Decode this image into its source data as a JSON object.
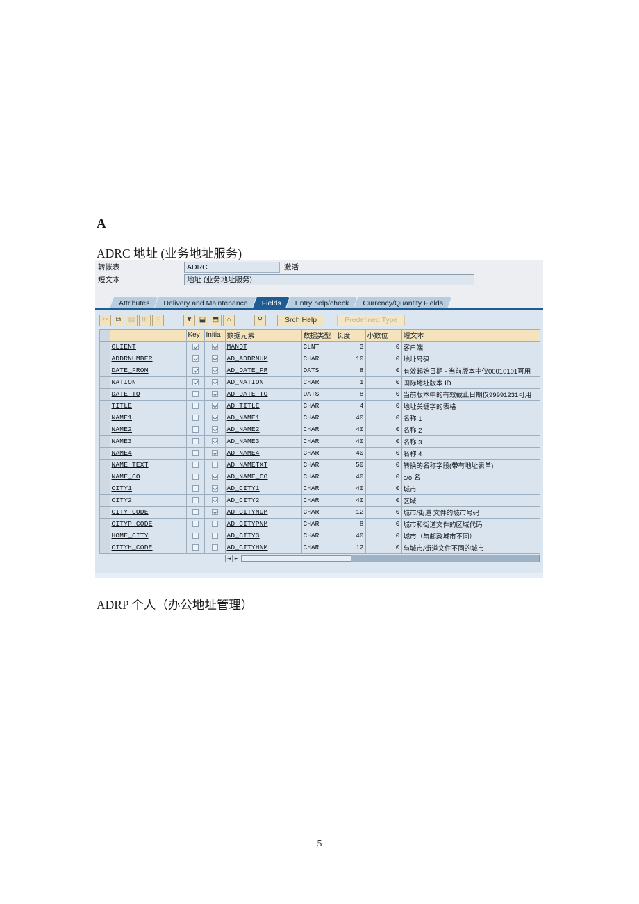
{
  "document": {
    "section_letter": "A",
    "adrc_caption": "ADRC 地址 (业务地址服务)",
    "adrp_caption": "ADRP 个人（办公地址管理）",
    "page_number": "5"
  },
  "sap": {
    "form": {
      "row1_label": "转帐表",
      "row1_value": "ADRC",
      "row1_status": "激活",
      "row2_label": "短文本",
      "row2_value": "地址 (业务地址服务)"
    },
    "tabs": [
      {
        "label": "Attributes",
        "active": false
      },
      {
        "label": "Delivery and Maintenance",
        "active": false
      },
      {
        "label": "Fields",
        "active": true
      },
      {
        "label": "Entry help/check",
        "active": false
      },
      {
        "label": "Currency/Quantity Fields",
        "active": false
      }
    ],
    "toolbar": {
      "icons": [
        {
          "name": "cut-icon",
          "glyph": "✂",
          "disabled": true
        },
        {
          "name": "copy-icon",
          "glyph": "⧉",
          "disabled": false
        },
        {
          "name": "paste-icon",
          "glyph": "▤",
          "disabled": true
        },
        {
          "name": "insert-row-icon",
          "glyph": "⊞",
          "disabled": true
        },
        {
          "name": "delete-row-icon",
          "glyph": "⊟",
          "disabled": true
        },
        {
          "name": "filter-icon",
          "glyph": "▼",
          "disabled": false
        },
        {
          "name": "append-row-icon",
          "glyph": "⬓",
          "disabled": false
        },
        {
          "name": "insert-line-icon",
          "glyph": "⬒",
          "disabled": false
        },
        {
          "name": "sort-icon",
          "glyph": "⌂",
          "disabled": false
        },
        {
          "name": "data-element-icon",
          "glyph": "⚲",
          "disabled": false
        }
      ],
      "srch_help_label": "Srch Help",
      "predefined_type_label": "Predefined Type"
    },
    "grid": {
      "columns": [
        {
          "key": "field",
          "label": ""
        },
        {
          "key": "key",
          "label": "Key"
        },
        {
          "key": "initial",
          "label": "Initia"
        },
        {
          "key": "data_element",
          "label": "数据元素"
        },
        {
          "key": "data_type",
          "label": "数据类型"
        },
        {
          "key": "length",
          "label": "长度"
        },
        {
          "key": "decimals",
          "label": "小数位"
        },
        {
          "key": "short_text",
          "label": "短文本"
        }
      ],
      "rows": [
        {
          "field": "CLIENT",
          "key": true,
          "initial": true,
          "data_element": "MANDT",
          "data_type": "CLNT",
          "length": "3",
          "decimals": "0",
          "short_text": "客户端"
        },
        {
          "field": "ADDRNUMBER",
          "key": true,
          "initial": true,
          "data_element": "AD_ADDRNUM",
          "data_type": "CHAR",
          "length": "10",
          "decimals": "0",
          "short_text": "地址号码"
        },
        {
          "field": "DATE_FROM",
          "key": true,
          "initial": true,
          "data_element": "AD_DATE_FR",
          "data_type": "DATS",
          "length": "8",
          "decimals": "0",
          "short_text": "有效起始日期 - 当前版本中仅00010101可用"
        },
        {
          "field": "NATION",
          "key": true,
          "initial": true,
          "data_element": "AD_NATION",
          "data_type": "CHAR",
          "length": "1",
          "decimals": "0",
          "short_text": "国际地址版本 ID"
        },
        {
          "field": "DATE_TO",
          "key": false,
          "initial": true,
          "data_element": "AD_DATE_TO",
          "data_type": "DATS",
          "length": "8",
          "decimals": "0",
          "short_text": "当前版本中的有效截止日期仅99991231可用"
        },
        {
          "field": "TITLE",
          "key": false,
          "initial": true,
          "data_element": "AD_TITLE",
          "data_type": "CHAR",
          "length": "4",
          "decimals": "0",
          "short_text": "地址关键字的表格"
        },
        {
          "field": "NAME1",
          "key": false,
          "initial": true,
          "data_element": "AD_NAME1",
          "data_type": "CHAR",
          "length": "40",
          "decimals": "0",
          "short_text": "名称 1"
        },
        {
          "field": "NAME2",
          "key": false,
          "initial": true,
          "data_element": "AD_NAME2",
          "data_type": "CHAR",
          "length": "40",
          "decimals": "0",
          "short_text": "名称 2"
        },
        {
          "field": "NAME3",
          "key": false,
          "initial": true,
          "data_element": "AD_NAME3",
          "data_type": "CHAR",
          "length": "40",
          "decimals": "0",
          "short_text": "名称 3"
        },
        {
          "field": "NAME4",
          "key": false,
          "initial": true,
          "data_element": "AD_NAME4",
          "data_type": "CHAR",
          "length": "40",
          "decimals": "0",
          "short_text": "名称 4"
        },
        {
          "field": "NAME_TEXT",
          "key": false,
          "initial": false,
          "data_element": "AD_NAMETXT",
          "data_type": "CHAR",
          "length": "50",
          "decimals": "0",
          "short_text": "转换的名称字段(带有地址表单)"
        },
        {
          "field": "NAME_CO",
          "key": false,
          "initial": true,
          "data_element": "AD_NAME_CO",
          "data_type": "CHAR",
          "length": "40",
          "decimals": "0",
          "short_text": "c/o 名"
        },
        {
          "field": "CITY1",
          "key": false,
          "initial": true,
          "data_element": "AD_CITY1",
          "data_type": "CHAR",
          "length": "40",
          "decimals": "0",
          "short_text": "城市"
        },
        {
          "field": "CITY2",
          "key": false,
          "initial": true,
          "data_element": "AD_CITY2",
          "data_type": "CHAR",
          "length": "40",
          "decimals": "0",
          "short_text": "区域"
        },
        {
          "field": "CITY_CODE",
          "key": false,
          "initial": true,
          "data_element": "AD_CITYNUM",
          "data_type": "CHAR",
          "length": "12",
          "decimals": "0",
          "short_text": "城市/街道 文件的城市号码"
        },
        {
          "field": "CITYP_CODE",
          "key": false,
          "initial": false,
          "data_element": "AD_CITYPNM",
          "data_type": "CHAR",
          "length": "8",
          "decimals": "0",
          "short_text": "城市和街道文件的区域代码"
        },
        {
          "field": "HOME_CITY",
          "key": false,
          "initial": false,
          "data_element": "AD_CITY3",
          "data_type": "CHAR",
          "length": "40",
          "decimals": "0",
          "short_text": "城市（与邮政城市不同）"
        },
        {
          "field": "CITYH_CODE",
          "key": false,
          "initial": false,
          "data_element": "AD_CITYHNM",
          "data_type": "CHAR",
          "length": "12",
          "decimals": "0",
          "short_text": "与城市/街道文件不同的城市"
        }
      ]
    },
    "scroll": {
      "prev_label": "◄",
      "next_label": "►"
    }
  }
}
